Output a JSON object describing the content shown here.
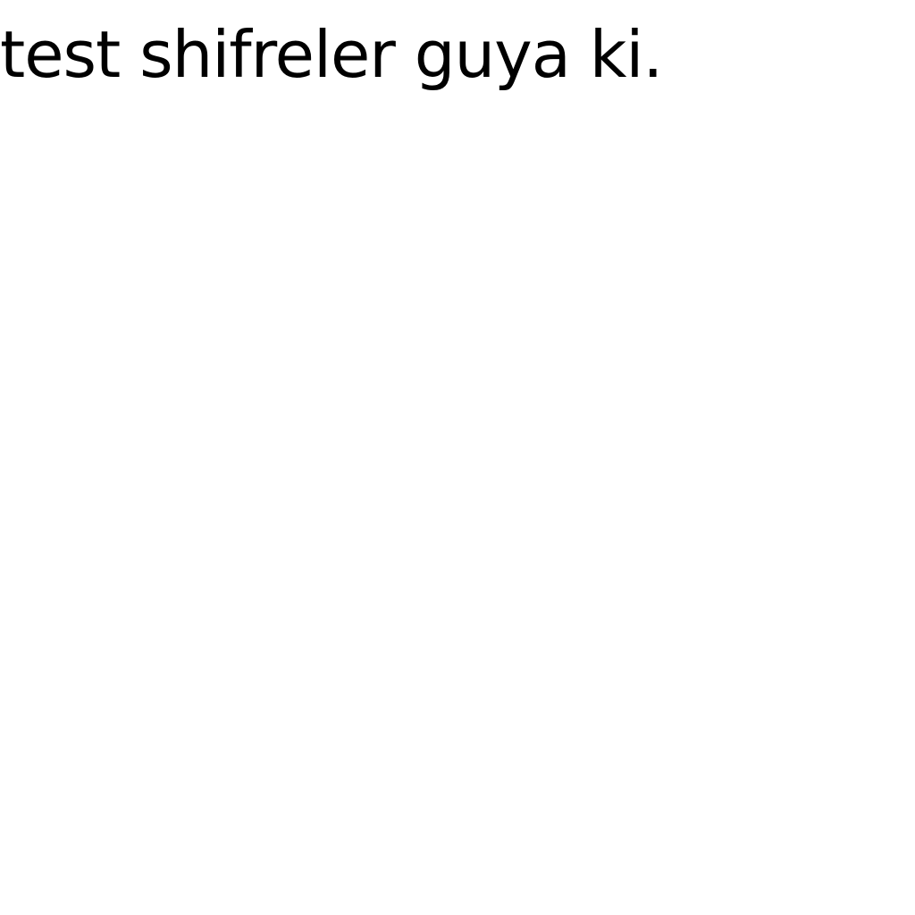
{
  "content": {
    "text": "test shifreler guya ki."
  },
  "colors": {
    "background": "#ffffff",
    "text": "#000000"
  }
}
